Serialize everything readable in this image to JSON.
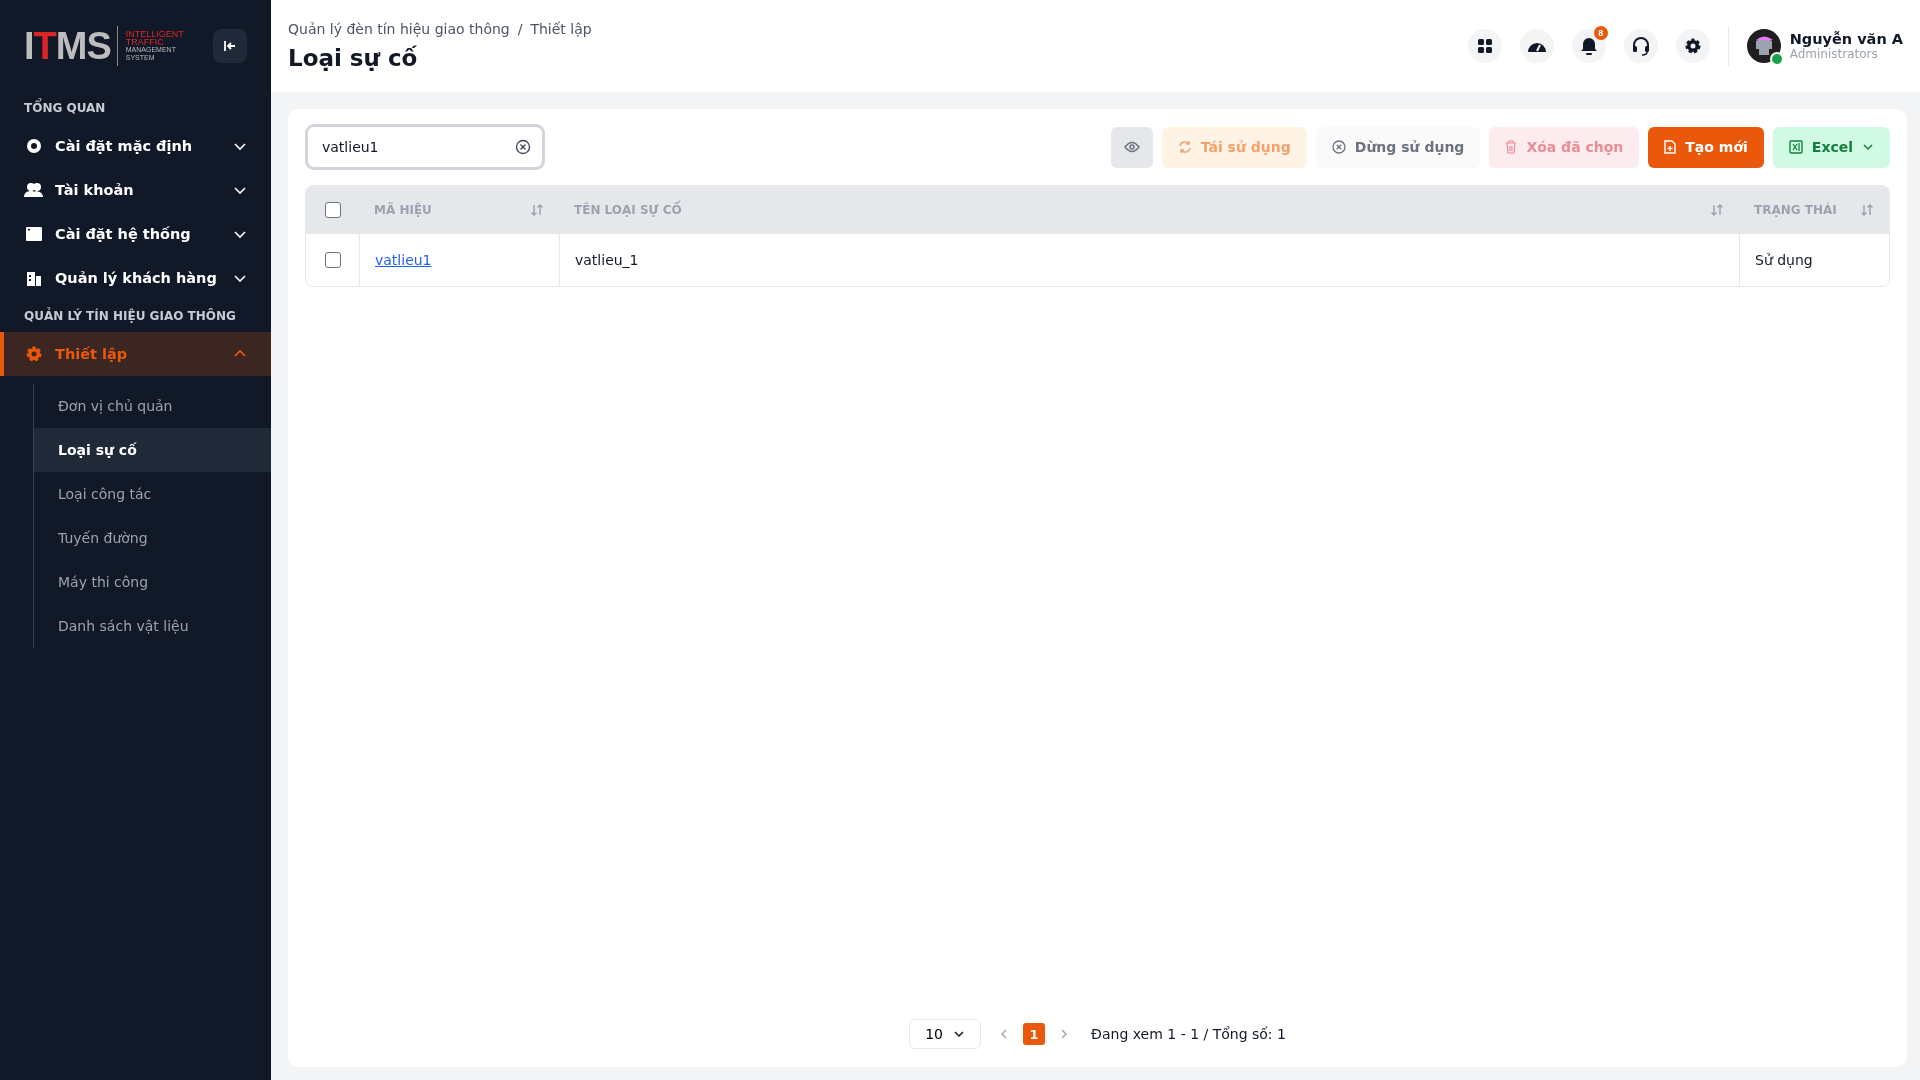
{
  "sidebar": {
    "logo": {
      "mark_start": "I",
      "mark_accent": "T",
      "mark_end": "MS",
      "tagline_top": [
        "INTELLIGENT",
        "TRAFFIC"
      ],
      "tagline_bottom": [
        "MANAGEMENT",
        "SYSTEM"
      ]
    },
    "sections": [
      {
        "title": "TỔNG QUAN",
        "items": [
          {
            "label": "Cài đặt mặc định",
            "kind": "defaults",
            "selected": false,
            "expanded": false
          },
          {
            "label": "Tài khoản",
            "kind": "accounts",
            "selected": false,
            "expanded": false
          },
          {
            "label": "Cài đặt hệ thống",
            "kind": "system",
            "selected": false,
            "expanded": false
          },
          {
            "label": "Quản lý khách hàng",
            "kind": "customers",
            "selected": false,
            "expanded": false
          }
        ]
      },
      {
        "title": "QUẢN LÝ TÍN HIỆU GIAO THÔNG",
        "items": [
          {
            "label": "Thiết lập",
            "kind": "setup",
            "selected": true,
            "expanded": true,
            "children": [
              {
                "label": "Đơn vị chủ quản",
                "selected": false
              },
              {
                "label": "Loại sự cố",
                "selected": true
              },
              {
                "label": "Loại công tác",
                "selected": false
              },
              {
                "label": "Tuyến đường",
                "selected": false
              },
              {
                "label": "Máy thi công",
                "selected": false
              },
              {
                "label": "Danh sách vật liệu",
                "selected": false
              }
            ]
          }
        ]
      }
    ]
  },
  "header": {
    "breadcrumb": [
      "Quản lý đèn tín hiệu giao thông",
      "Thiết lập"
    ],
    "breadcrumb_separator": "/",
    "title": "Loại sự cố",
    "actions": [
      {
        "kind": "apps"
      },
      {
        "kind": "dashboard"
      },
      {
        "kind": "notifications",
        "badge": "8"
      },
      {
        "kind": "support"
      },
      {
        "kind": "settings"
      }
    ],
    "user": {
      "name": "Nguyễn văn A",
      "role": "Administrators",
      "online": true
    }
  },
  "search": {
    "value": "vatlieu1"
  },
  "toolbar": [
    {
      "kind": "view",
      "disabled": false
    },
    {
      "kind": "reuse",
      "label": "Tái sử dụng",
      "disabled": true
    },
    {
      "kind": "stop",
      "label": "Dừng sử dụng",
      "disabled": true
    },
    {
      "kind": "delete",
      "label": "Xóa đã chọn",
      "disabled": true
    },
    {
      "kind": "create",
      "label": "Tạo mới",
      "disabled": false
    },
    {
      "kind": "excel",
      "label": "Excel",
      "disabled": false
    }
  ],
  "table": {
    "all_checked": false,
    "columns": [
      {
        "label": "MÃ HIỆU",
        "sortable": true
      },
      {
        "label": "TÊN LOẠI SỰ CỐ",
        "sortable": true
      },
      {
        "label": "TRẠNG THÁI",
        "sortable": true
      }
    ],
    "rows": [
      {
        "checked": false,
        "code": "vatlieu1",
        "name": "vatlieu_1",
        "status": "Sử dụng"
      }
    ]
  },
  "pagination": {
    "page_size": "10",
    "pages": [
      {
        "label": "1",
        "selected": true
      }
    ],
    "summary": "Đang xem 1 - 1 / Tổng số: 1"
  }
}
